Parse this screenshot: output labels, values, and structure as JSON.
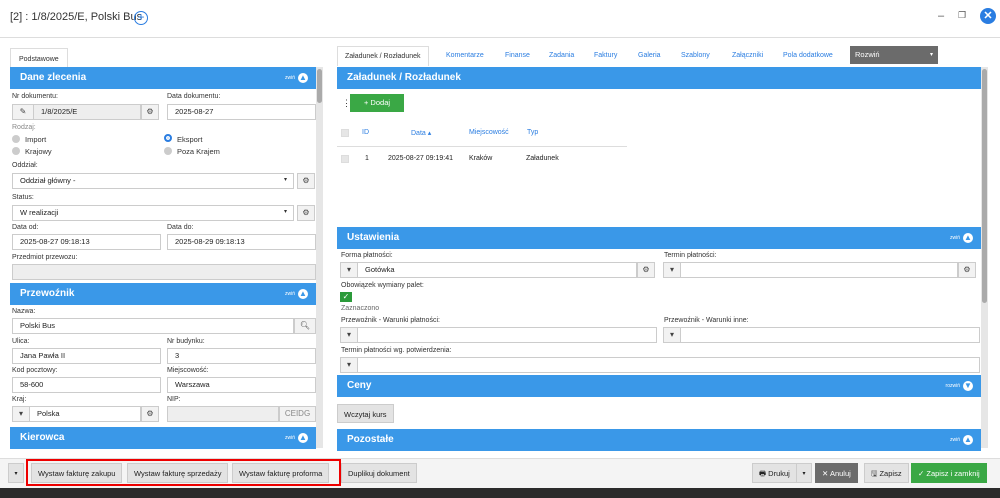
{
  "window": {
    "title": "[2] : 1/8/2025/E, Polski Bus",
    "minimize": "–",
    "restore": "❐",
    "close": "✕"
  },
  "left": {
    "tab": "Podstawowe",
    "dane": {
      "title": "Dane zlecenia",
      "collapse": "zwiń",
      "nr_label": "Nr dokumentu:",
      "nr_value": "1/8/2025/E",
      "data_label": "Data dokumentu:",
      "data_value": "2025-08-27",
      "rodzaj_label": "Rodzaj:",
      "import": "Import",
      "eksport": "Eksport",
      "krajowy": "Krajowy",
      "poza": "Poza Krajem",
      "oddzial_label": "Oddział:",
      "oddzial_value": "Oddział główny -",
      "status_label": "Status:",
      "status_value": "W realizacji",
      "od_label": "Data od:",
      "od_value": "2025-08-27 09:18:13",
      "do_label": "Data do:",
      "do_value": "2025-08-29 09:18:13",
      "przedmiot_label": "Przedmiot przewozu:"
    },
    "przewoznik": {
      "title": "Przewoźnik",
      "collapse": "zwiń",
      "nazwa_label": "Nazwa:",
      "nazwa_value": "Polski Bus",
      "ulica_label": "Ulica:",
      "ulica_value": "Jana Pawła II",
      "nrb_label": "Nr budynku:",
      "nrb_value": "3",
      "kod_label": "Kod pocztowy:",
      "kod_value": "58-600",
      "miej_label": "Miejscowość:",
      "miej_value": "Warszawa",
      "kraj_label": "Kraj:",
      "kraj_value": "Polska",
      "nip_label": "NIP:",
      "ceidg": "CEIDG"
    },
    "kierowca": {
      "title": "Kierowca",
      "collapse": "zwiń"
    }
  },
  "right": {
    "tabs": [
      "Załadunek / Rozładunek",
      "Komentarze",
      "Finanse",
      "Zadania",
      "Faktury",
      "Galeria",
      "Szablony",
      "Załączniki",
      "Pola dodatkowe"
    ],
    "rozwin": "Rozwiń",
    "zal": {
      "title": "Załadunek / Rozładunek",
      "dodaj": "+ Dodaj",
      "headers": {
        "id": "ID",
        "data": "Data ▴",
        "miejsc": "Miejscowość",
        "typ": "Typ"
      },
      "rows": [
        {
          "id": "1",
          "data": "2025-08-27 09:19:41",
          "miejsc": "Kraków",
          "typ": "Załadunek"
        }
      ]
    },
    "ust": {
      "title": "Ustawienia",
      "collapse": "zwiń",
      "forma_label": "Forma płatności:",
      "forma_value": "Gotówka",
      "termin_label": "Termin płatności:",
      "palet_label": "Obowiązek wymiany palet:",
      "zaznaczono": "Zaznaczono",
      "wp_label": "Przewoźnik - Warunki płatności:",
      "wi_label": "Przewoźnik - Warunki inne:",
      "tp_label": "Termin płatności wg. potwierdzenia:"
    },
    "ceny": {
      "title": "Ceny",
      "expand": "rozwiń"
    },
    "wczytaj": "Wczytaj kurs",
    "pozostale": {
      "title": "Pozostałe",
      "collapse": "zwiń"
    }
  },
  "footer": {
    "zakup": "Wystaw fakturę zakupu",
    "sprzedaz": "Wystaw fakturę sprzedaży",
    "proforma": "Wystaw fakturę proforma",
    "duplikuj": "Duplikuj dokument",
    "drukuj": "🖶 Drukuj",
    "anuluj": "✕ Anuluj",
    "zapisz": "🖫 Zapisz",
    "zapisz_zamknij": "✓ Zapisz i zamknij"
  }
}
